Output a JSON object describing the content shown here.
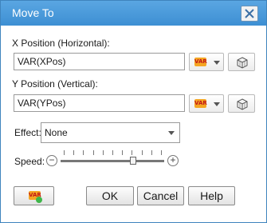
{
  "window": {
    "title": "Move To"
  },
  "fields": {
    "x_label": "X Position (Horizontal):",
    "x_value": "VAR(XPos)",
    "y_label": "Y Position (Vertical):",
    "y_value": "VAR(YPos)",
    "var_badge": "VAR"
  },
  "effect": {
    "label": "Effect:",
    "value": "None"
  },
  "speed": {
    "label": "Speed:",
    "minus": "−",
    "plus": "+",
    "level": 0.7
  },
  "buttons": {
    "ok": "OK",
    "cancel": "Cancel",
    "help": "Help"
  },
  "icons": [
    "close-icon",
    "variable-icon",
    "cube-icon",
    "chevron-down-icon",
    "minus-icon",
    "plus-icon",
    "add-variable-icon"
  ],
  "colors": {
    "title_bar": "#4a9ad9",
    "var_badge": "#f5a623",
    "var_text": "#c21818",
    "add_green": "#3fb64a"
  }
}
